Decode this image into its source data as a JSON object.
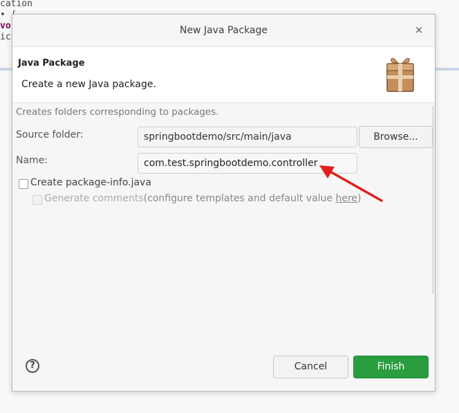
{
  "editor": {
    "lines": [
      "cation",
      "• {",
      "vo",
      "ic"
    ]
  },
  "dialog": {
    "title": "New Java Package",
    "close_glyph": "×",
    "banner": {
      "title": "Java Package",
      "subtitle": "Create a new Java package.",
      "icon": "package-icon"
    },
    "description": "Creates folders corresponding to packages.",
    "source_folder": {
      "label": "Source folder:",
      "value": "springbootdemo/src/main/java",
      "browse_label": "Browse..."
    },
    "name": {
      "label": "Name:",
      "value": "com.test.springbootdemo.controller"
    },
    "create_package_info": {
      "label": "Create package-info.java",
      "checked": false
    },
    "generate_comments": {
      "label": "Generate comments",
      "suffix_before": "(configure templates and default value ",
      "link": "here",
      "suffix_after": ")",
      "checked": false,
      "enabled": false
    },
    "footer": {
      "help_glyph": "?",
      "cancel_label": "Cancel",
      "finish_label": "Finish"
    },
    "colors": {
      "finish": "#2a9d3f",
      "arrow": "#e0201c"
    }
  }
}
